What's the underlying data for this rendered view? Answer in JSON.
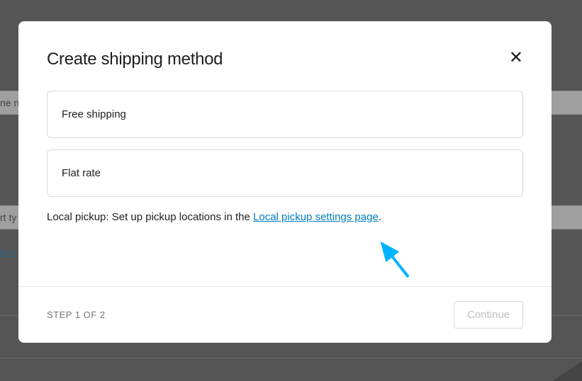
{
  "background": {
    "row1_text": "ne n",
    "row2_text": "rt ty",
    "link_text": "to s"
  },
  "modal": {
    "title": "Create shipping method",
    "options": [
      {
        "label": "Free shipping"
      },
      {
        "label": "Flat rate"
      }
    ],
    "pickup": {
      "prefix": "Local pickup: Set up pickup locations in the ",
      "link": "Local pickup settings page",
      "suffix": "."
    },
    "footer": {
      "step": "STEP 1 OF 2",
      "continue": "Continue"
    }
  }
}
